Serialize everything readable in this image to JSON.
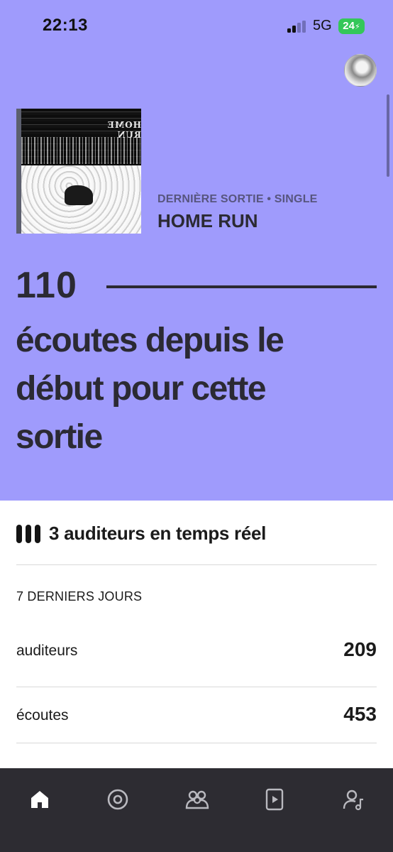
{
  "status_bar": {
    "time": "22:13",
    "network": "5G",
    "battery": "24",
    "battery_icon": "charging-bolt"
  },
  "colors": {
    "hero_background": "#9f9bfc",
    "text_dark": "#2b2a33",
    "subtitle": "#57557e",
    "nav_background": "#2d2c32",
    "battery_green": "#34c759"
  },
  "latest_release": {
    "kind": "DERNIÈRE SORTIE • SINGLE",
    "title": "HOME RUN",
    "cover_text": "HOME RUN"
  },
  "streams_highlight": {
    "count": "110",
    "caption": "écoutes depuis le début pour cette sortie"
  },
  "realtime": {
    "icon": "bars-icon",
    "label": "3 auditeurs en temps réel"
  },
  "last_7_days": {
    "heading": "7 DERNIERS JOURS",
    "rows": [
      {
        "label": "auditeurs",
        "value": "209"
      },
      {
        "label": "écoutes",
        "value": "453"
      }
    ]
  },
  "bottom_nav": {
    "items": [
      {
        "name": "home",
        "icon": "home-icon",
        "active": true
      },
      {
        "name": "music",
        "icon": "disc-icon",
        "active": false
      },
      {
        "name": "audience",
        "icon": "people-icon",
        "active": false
      },
      {
        "name": "videos",
        "icon": "play-icon",
        "active": false
      },
      {
        "name": "profile",
        "icon": "artist-icon",
        "active": false
      }
    ]
  }
}
